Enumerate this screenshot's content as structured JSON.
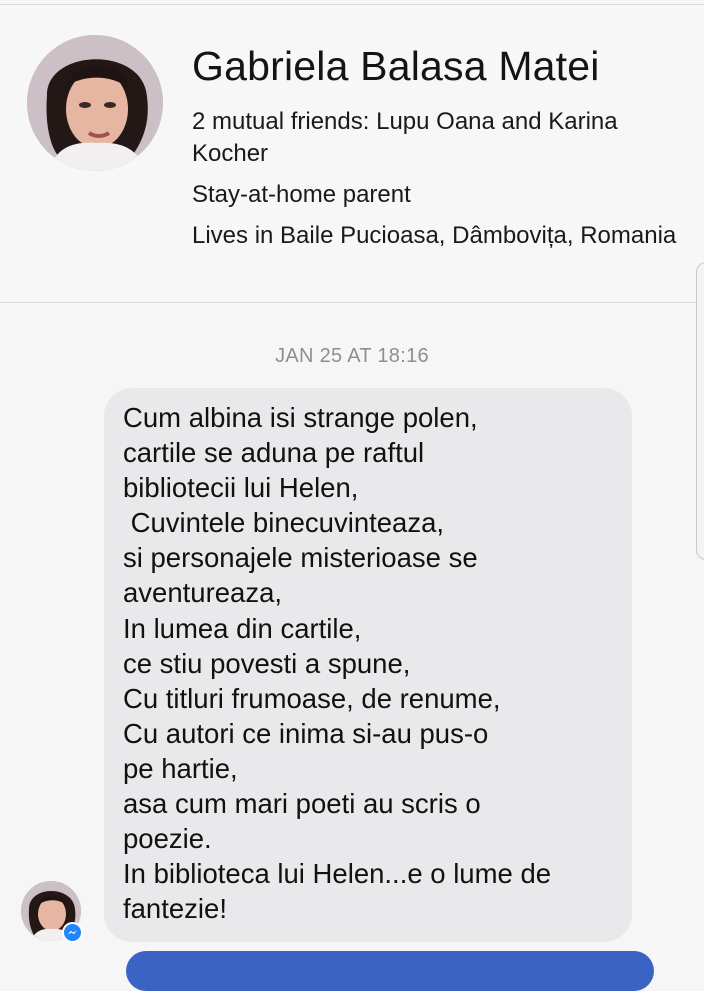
{
  "profile": {
    "name": "Gabriela Balasa Matei",
    "mutual_friends": "2 mutual friends: Lupu Oana and Karina Kocher",
    "occupation": "Stay-at-home parent",
    "location": "Lives in Baile Pucioasa, Dâmbovița, Romania"
  },
  "conversation": {
    "timestamp": "JAN 25 AT 18:16",
    "message_lines": [
      "Cum albina isi strange polen,",
      "cartile se aduna pe raftul",
      "bibliotecii lui Helen,",
      " Cuvintele binecuvinteaza,",
      "si personajele misterioase se",
      "aventureaza,",
      "In lumea din cartile,",
      "ce stiu povesti a spune,",
      "Cu titluri frumoase, de renume,",
      "Cu autori ce inima si-au pus-o",
      "pe hartie,",
      "asa cum mari poeti au scris o",
      "poezie.",
      "In biblioteca lui Helen...e o lume de",
      "fantezie!"
    ]
  },
  "icons": {
    "badge": "messenger-icon"
  },
  "colors": {
    "bubble": "#e9e9eb",
    "messenger_blue": "#1e87ff",
    "outgoing_bubble": "#3a63c4"
  }
}
